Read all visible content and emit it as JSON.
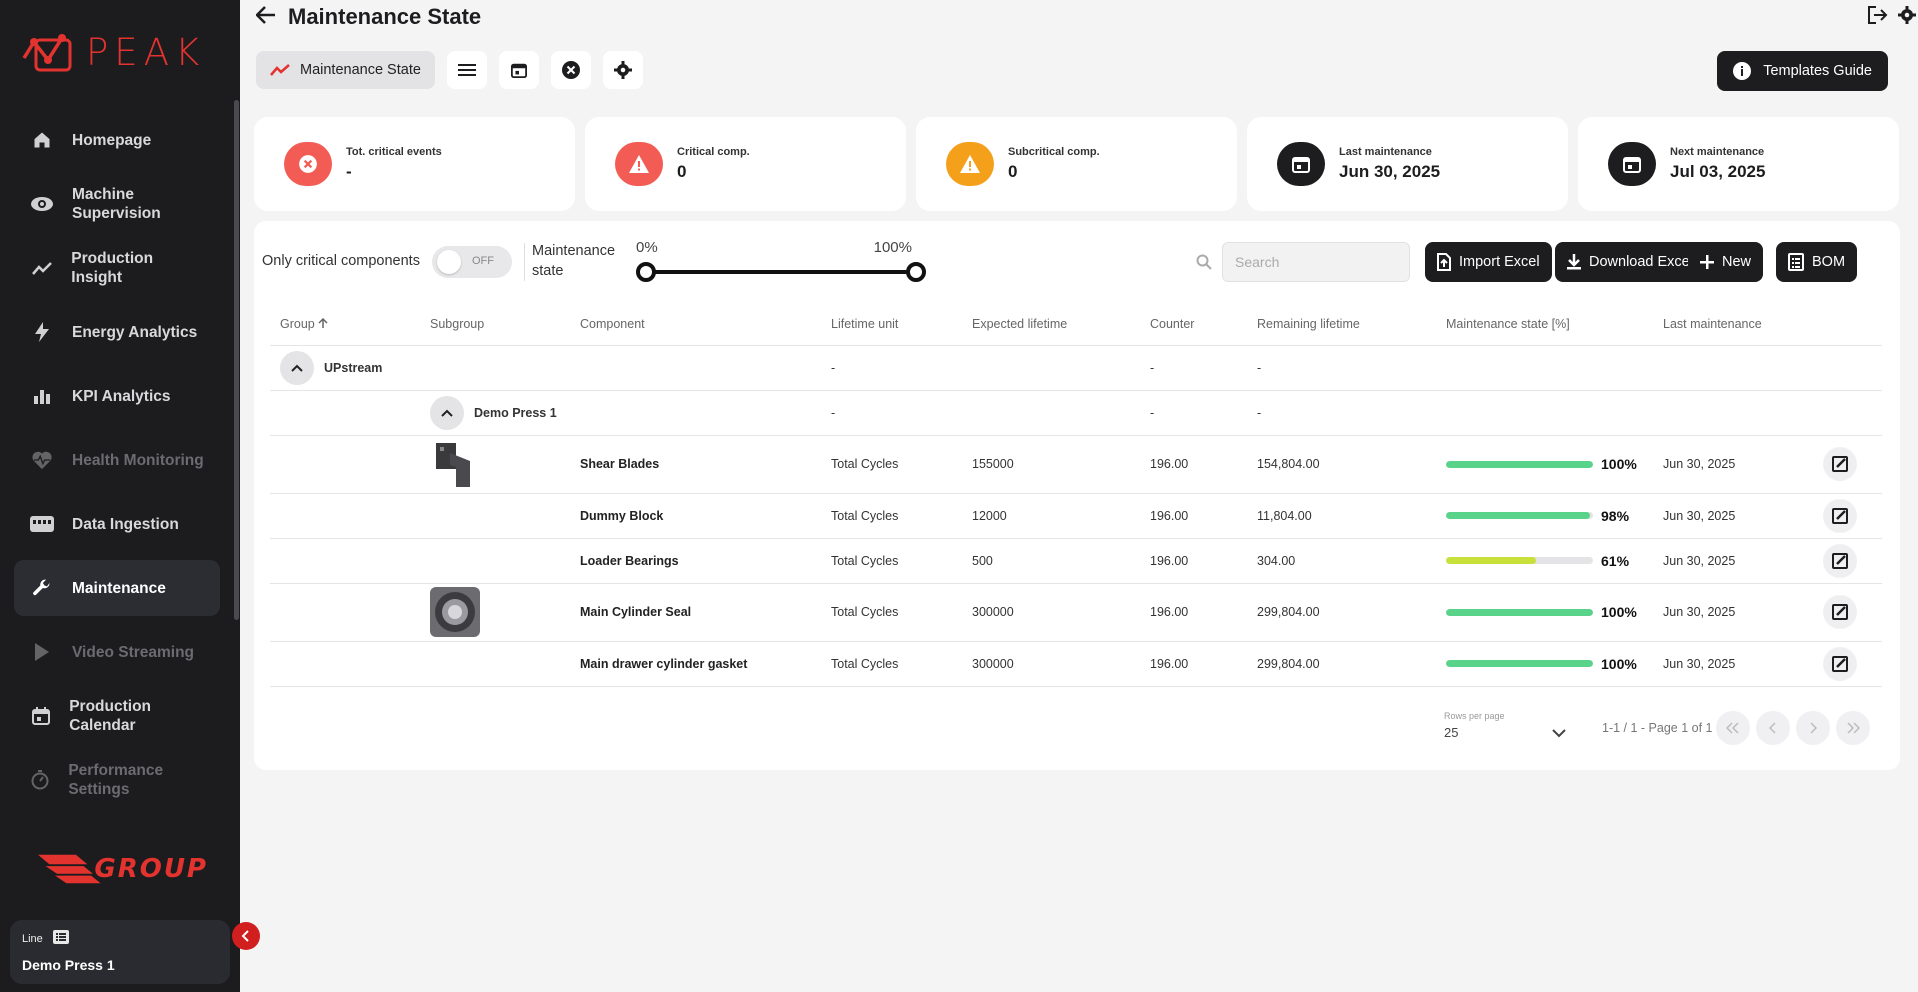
{
  "app": {
    "brand": "PEAK",
    "group_brand": "GROUP"
  },
  "sidebar": {
    "items": [
      {
        "label": "Homepage",
        "icon": "home-icon",
        "state": "normal"
      },
      {
        "label": "Machine Supervision",
        "icon": "eye-icon",
        "state": "normal"
      },
      {
        "label": "Production Insight",
        "icon": "trend-icon",
        "state": "normal"
      },
      {
        "label": "Energy Analytics",
        "icon": "bolt-icon",
        "state": "normal"
      },
      {
        "label": "KPI Analytics",
        "icon": "bar-chart-icon",
        "state": "normal"
      },
      {
        "label": "Health Monitoring",
        "icon": "heart-pulse-icon",
        "state": "disabled"
      },
      {
        "label": "Data Ingestion",
        "icon": "ingestion-icon",
        "state": "normal"
      },
      {
        "label": "Maintenance",
        "icon": "wrench-icon",
        "state": "active"
      },
      {
        "label": "Video Streaming",
        "icon": "play-icon",
        "state": "disabled"
      },
      {
        "label": "Production Calendar",
        "icon": "calendar-icon",
        "state": "normal"
      },
      {
        "label": "Performance Settings",
        "icon": "gauge-icon",
        "state": "disabled"
      }
    ],
    "line": {
      "label": "Line",
      "value": "Demo Press 1"
    }
  },
  "header": {
    "title": "Maintenance State"
  },
  "toolbar": {
    "chip_label": "Maintenance State",
    "templates_label": "Templates Guide"
  },
  "cards": [
    {
      "label": "Tot. critical events",
      "value": "-",
      "icon": "close-circle-icon",
      "color": "#f25c54"
    },
    {
      "label": "Critical comp.",
      "value": "0",
      "icon": "warning-icon",
      "color": "#f25c54"
    },
    {
      "label": "Subcritical comp.",
      "value": "0",
      "icon": "warning-icon",
      "color": "#f5a01a"
    },
    {
      "label": "Last maintenance",
      "value": "Jun 30, 2025",
      "icon": "calendar-icon",
      "color": "#1d1d1f"
    },
    {
      "label": "Next maintenance",
      "value": "Jul 03, 2025",
      "icon": "calendar-icon",
      "color": "#1d1d1f"
    }
  ],
  "filters": {
    "critical_label": "Only critical components",
    "toggle_state": "OFF",
    "maintenance_state_label": "Maintenance state",
    "slider_min": "0%",
    "slider_max": "100%",
    "search_placeholder": "Search"
  },
  "actions": {
    "import": "Import Excel",
    "download": "Download Excel",
    "new": "New",
    "bom": "BOM"
  },
  "table": {
    "columns": [
      "Group",
      "Subgroup",
      "Component",
      "Lifetime unit",
      "Expected lifetime",
      "Counter",
      "Remaining lifetime",
      "Maintenance state [%]",
      "Last maintenance"
    ],
    "group": {
      "name": "UPstream",
      "lifetime_unit": "-",
      "counter": "-",
      "remaining": "-"
    },
    "subgroup": {
      "name": "Demo Press 1",
      "lifetime_unit": "-",
      "counter": "-",
      "remaining": "-"
    },
    "rows": [
      {
        "component": "Shear Blades",
        "unit": "Total Cycles",
        "expected": "155000",
        "counter": "196.00",
        "remaining": "154,804.00",
        "state": 100,
        "state_label": "100%",
        "last": "Jun 30, 2025",
        "color": "#5ad38a",
        "thumb": "blade"
      },
      {
        "component": "Dummy Block",
        "unit": "Total Cycles",
        "expected": "12000",
        "counter": "196.00",
        "remaining": "11,804.00",
        "state": 98,
        "state_label": "98%",
        "last": "Jun 30, 2025",
        "color": "#5ad38a",
        "thumb": ""
      },
      {
        "component": "Loader Bearings",
        "unit": "Total Cycles",
        "expected": "500",
        "counter": "196.00",
        "remaining": "304.00",
        "state": 61,
        "state_label": "61%",
        "last": "Jun 30, 2025",
        "color": "#c8e03a",
        "thumb": ""
      },
      {
        "component": "Main Cylinder Seal",
        "unit": "Total Cycles",
        "expected": "300000",
        "counter": "196.00",
        "remaining": "299,804.00",
        "state": 100,
        "state_label": "100%",
        "last": "Jun 30, 2025",
        "color": "#5ad38a",
        "thumb": "bearing"
      },
      {
        "component": "Main drawer cylinder gasket",
        "unit": "Total Cycles",
        "expected": "300000",
        "counter": "196.00",
        "remaining": "299,804.00",
        "state": 100,
        "state_label": "100%",
        "last": "Jun 30, 2025",
        "color": "#5ad38a",
        "thumb": ""
      }
    ]
  },
  "pagination": {
    "rows_per_page_label": "Rows per page",
    "rows_per_page": "25",
    "range": "1-1 / 1 - Page 1 of 1"
  }
}
